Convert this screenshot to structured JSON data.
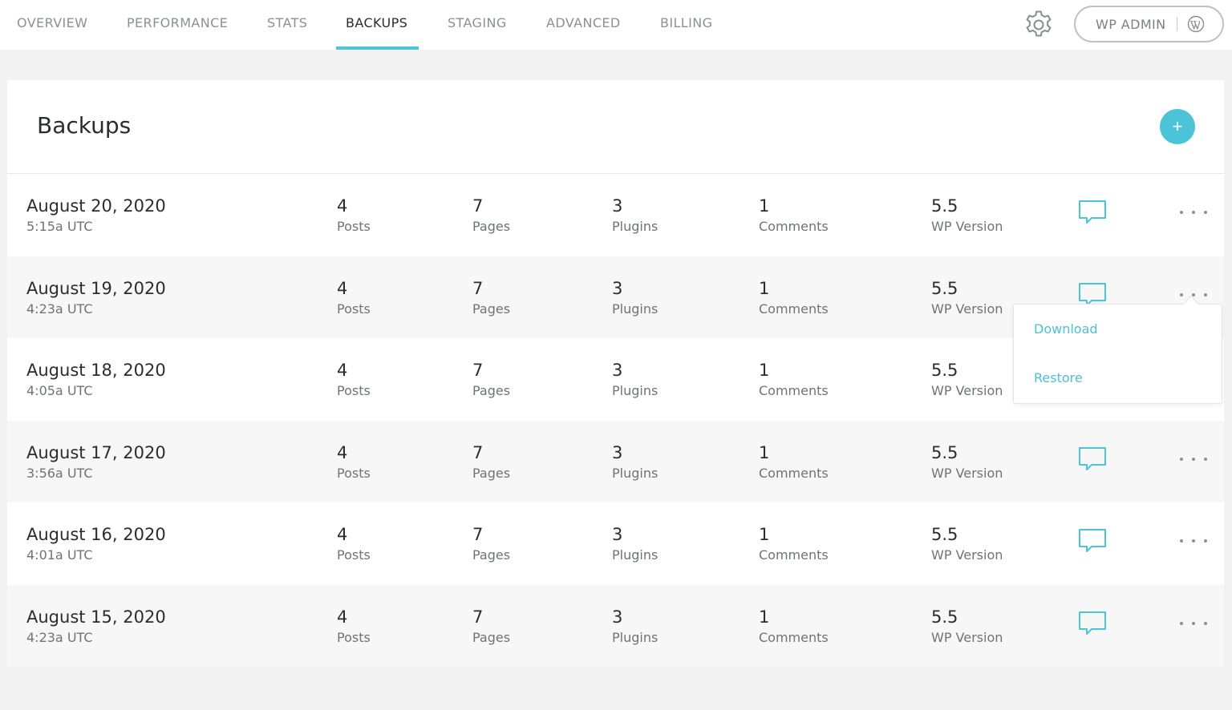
{
  "nav": {
    "tabs": [
      {
        "label": "OVERVIEW"
      },
      {
        "label": "PERFORMANCE"
      },
      {
        "label": "STATS"
      },
      {
        "label": "BACKUPS"
      },
      {
        "label": "STAGING"
      },
      {
        "label": "ADVANCED"
      },
      {
        "label": "BILLING"
      }
    ],
    "active_tab": "BACKUPS",
    "settings_icon": "gear-icon",
    "wp_admin_label": "WP ADMIN",
    "wp_admin_icon": "wordpress-logo-icon"
  },
  "panel": {
    "title": "Backups",
    "add_button_label": "+"
  },
  "column_labels": {
    "posts": "Posts",
    "pages": "Pages",
    "plugins": "Plugins",
    "comments": "Comments",
    "wp_version": "WP Version"
  },
  "backups": [
    {
      "date": "August 20, 2020",
      "time": "5:15a UTC",
      "posts": "4",
      "pages": "7",
      "plugins": "3",
      "comments": "1",
      "wp_version": "5.5"
    },
    {
      "date": "August 19, 2020",
      "time": "4:23a UTC",
      "posts": "4",
      "pages": "7",
      "plugins": "3",
      "comments": "1",
      "wp_version": "5.5"
    },
    {
      "date": "August 18, 2020",
      "time": "4:05a UTC",
      "posts": "4",
      "pages": "7",
      "plugins": "3",
      "comments": "1",
      "wp_version": "5.5"
    },
    {
      "date": "August 17, 2020",
      "time": "3:56a UTC",
      "posts": "4",
      "pages": "7",
      "plugins": "3",
      "comments": "1",
      "wp_version": "5.5"
    },
    {
      "date": "August 16, 2020",
      "time": "4:01a UTC",
      "posts": "4",
      "pages": "7",
      "plugins": "3",
      "comments": "1",
      "wp_version": "5.5"
    },
    {
      "date": "August 15, 2020",
      "time": "4:23a UTC",
      "posts": "4",
      "pages": "7",
      "plugins": "3",
      "comments": "1",
      "wp_version": "5.5"
    }
  ],
  "dropdown": {
    "items": [
      {
        "label": "Download"
      },
      {
        "label": "Restore"
      }
    ]
  },
  "colors": {
    "accent": "#4cc4d8",
    "tab_text": "#8c8f94",
    "active_tab_text": "#2a2b2e",
    "row_alt": "#f7f7f7",
    "page_bg": "#f2f2f2"
  }
}
